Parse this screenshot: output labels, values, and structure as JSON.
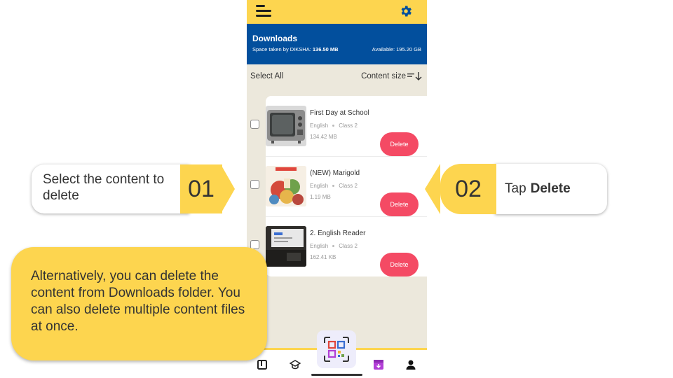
{
  "colors": {
    "accent_yellow": "#fdd54f",
    "banner_blue": "#024f9d",
    "delete_red": "#f44a64",
    "bg": "#ece8dc"
  },
  "app": {
    "menu_icon": "hamburger-icon",
    "settings_icon": "gear-icon",
    "banner": {
      "title": "Downloads",
      "space_label": "Space taken by DIKSHA:",
      "space_value": "136.50 MB",
      "available": "Available: 195.20 GB"
    },
    "select_all": "Select All",
    "sort_label": "Content size",
    "items": [
      {
        "title": "First Day at School",
        "language": "English",
        "class": "Class 2",
        "size": "134.42 MB",
        "delete_label": "Delete",
        "thumb_icon": "tv-thumbnail"
      },
      {
        "title": "(NEW) Marigold",
        "language": "English",
        "class": "Class 2",
        "size": "1.19 MB",
        "delete_label": "Delete",
        "thumb_icon": "book-cover-thumbnail"
      },
      {
        "title": "2. English Reader",
        "language": "English",
        "class": "Class 2",
        "size": "162.41 KB",
        "delete_label": "Delete",
        "thumb_icon": "screen-thumbnail"
      }
    ],
    "bottom_nav": [
      "library-icon",
      "courses-icon",
      "qr-scan-icon",
      "downloads-icon",
      "profile-icon"
    ]
  },
  "callouts": {
    "step1": {
      "number": "01",
      "text": "Select the content to delete"
    },
    "step2": {
      "number": "02",
      "text_prefix": "Tap",
      "text_bold": "Delete"
    },
    "note": "Alternatively, you can delete the content from Downloads folder. You can also delete multiple content files at once."
  }
}
